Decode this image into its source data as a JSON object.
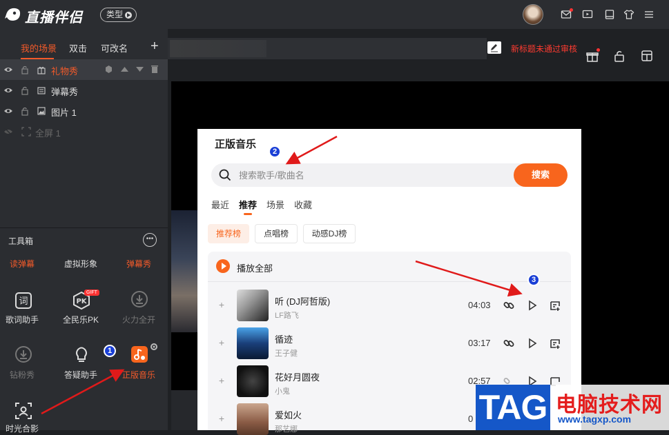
{
  "app": {
    "name": "直播伴侣",
    "type_button": "类型"
  },
  "scene_tabs": [
    "我的场景",
    "双击",
    "可改名"
  ],
  "layers": [
    {
      "name": "礼物秀",
      "selected": true
    },
    {
      "name": "弹幕秀",
      "selected": false
    },
    {
      "name": "图片 1",
      "selected": false
    },
    {
      "name": "全屏 1",
      "disabled": true
    }
  ],
  "toolbox": {
    "title": "工具箱",
    "row1": [
      "读弹幕",
      "虚拟形象",
      "弹幕秀"
    ],
    "row2": [
      "歌词助手",
      "全民乐PK",
      "火力全开"
    ],
    "row3": [
      "钻粉秀",
      "答疑助手",
      "正版音乐"
    ],
    "row4": [
      "时光合影"
    ],
    "pk_badge": "GIFT"
  },
  "preview": {
    "warning": "新标题未通过审核"
  },
  "music": {
    "title": "正版音乐",
    "search_placeholder": "搜索歌手/歌曲名",
    "search_button": "搜索",
    "tabs": [
      "最近",
      "推荐",
      "场景",
      "收藏"
    ],
    "chips": [
      "推荐榜",
      "点唱榜",
      "动感DJ榜"
    ],
    "play_all": "播放全部",
    "songs": [
      {
        "name": "听 (DJ阿哲版)",
        "artist": "LF路飞",
        "duration": "04:03"
      },
      {
        "name": "循迹",
        "artist": "王子健",
        "duration": "03:17"
      },
      {
        "name": "花好月圆夜",
        "artist": "小鬼",
        "duration": "02:57"
      },
      {
        "name": "爱如火",
        "artist": "那艺娜",
        "duration": "0"
      }
    ]
  },
  "annotations": [
    "1",
    "2",
    "3"
  ],
  "watermark": {
    "tag": "TAG",
    "text": "电脑技术网",
    "url": "www.tagxp.com"
  },
  "colors": {
    "accent": "#f8651d",
    "warning": "#ff3b30",
    "badge": "#1a3fd6"
  }
}
